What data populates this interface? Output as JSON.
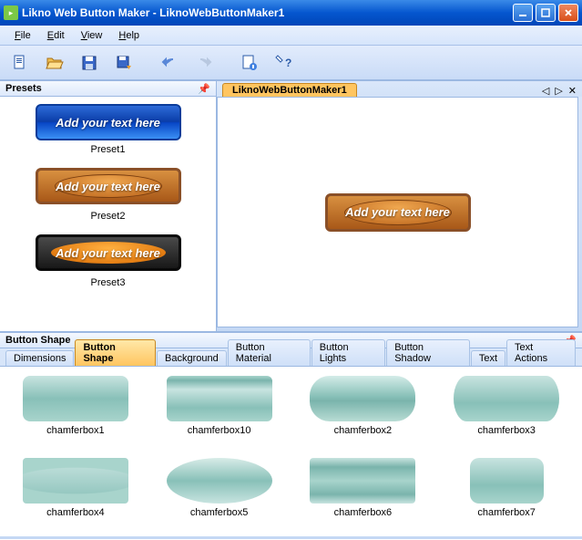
{
  "titlebar": {
    "app": "Likno Web Button Maker",
    "doc": "LiknoWebButtonMaker1"
  },
  "menu": {
    "file": "File",
    "edit": "Edit",
    "view": "View",
    "help": "Help"
  },
  "toolbar": {
    "new": "new",
    "open": "open",
    "save": "save",
    "saveas": "saveas",
    "undo": "undo",
    "redo": "redo",
    "props": "props",
    "help": "help"
  },
  "presets": {
    "title": "Presets",
    "sample_text": "Add your text here",
    "items": [
      {
        "label": "Preset1",
        "style": "blue"
      },
      {
        "label": "Preset2",
        "style": "wood"
      },
      {
        "label": "Preset3",
        "style": "dark"
      }
    ]
  },
  "document": {
    "tab": "LiknoWebButtonMaker1",
    "canvas_text": "Add your text here"
  },
  "button_shape": {
    "title": "Button Shape",
    "tabs": [
      {
        "label": "Dimensions",
        "active": false
      },
      {
        "label": "Button Shape",
        "active": true
      },
      {
        "label": "Background",
        "active": false
      },
      {
        "label": "Button Material",
        "active": false
      },
      {
        "label": "Button Lights",
        "active": false
      },
      {
        "label": "Button Shadow",
        "active": false
      },
      {
        "label": "Text",
        "active": false
      },
      {
        "label": "Text Actions",
        "active": false
      }
    ],
    "shapes": [
      {
        "label": "chamferbox1",
        "cls": "cf1"
      },
      {
        "label": "chamferbox10",
        "cls": "cf10"
      },
      {
        "label": "chamferbox2",
        "cls": "cf2"
      },
      {
        "label": "chamferbox3",
        "cls": "cf3"
      },
      {
        "label": "chamferbox4",
        "cls": "cf4"
      },
      {
        "label": "chamferbox5",
        "cls": "cf5"
      },
      {
        "label": "chamferbox6",
        "cls": "cf6"
      },
      {
        "label": "chamferbox7",
        "cls": "cf7"
      }
    ]
  }
}
